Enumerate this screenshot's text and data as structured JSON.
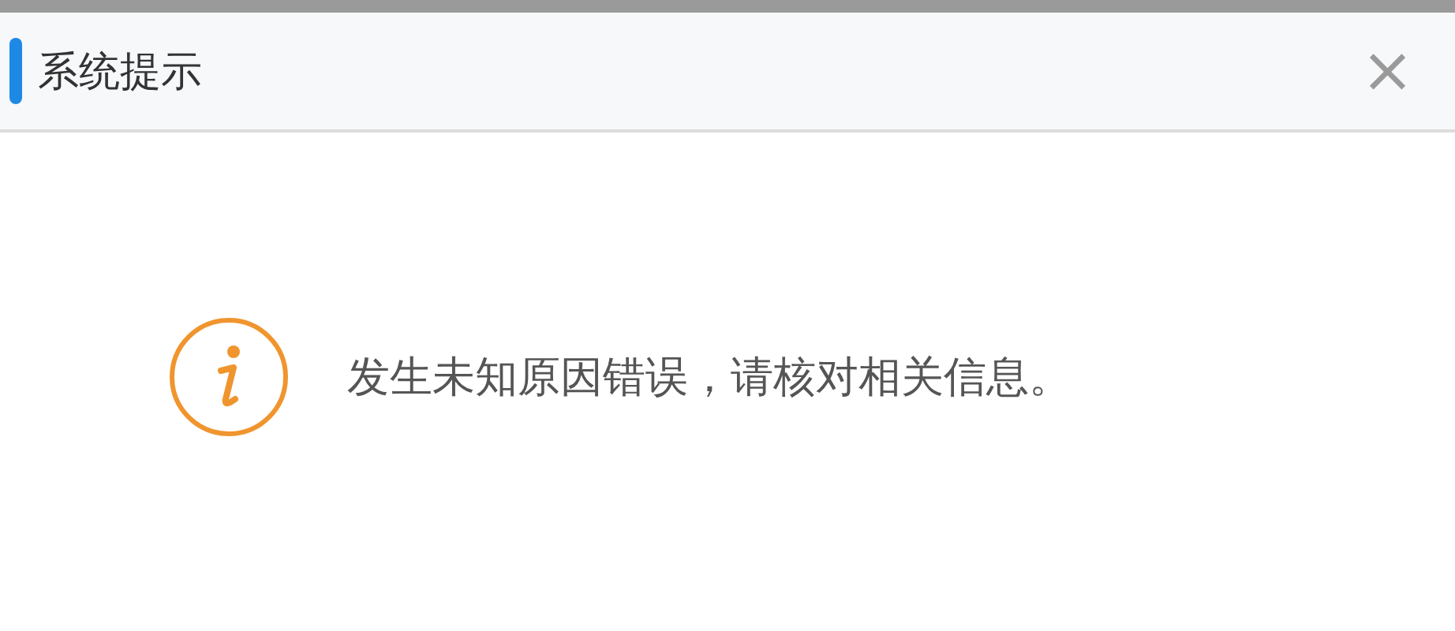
{
  "dialog": {
    "title": "系统提示",
    "close": "×",
    "message": "发生未知原因错误，请核对相关信息。"
  }
}
